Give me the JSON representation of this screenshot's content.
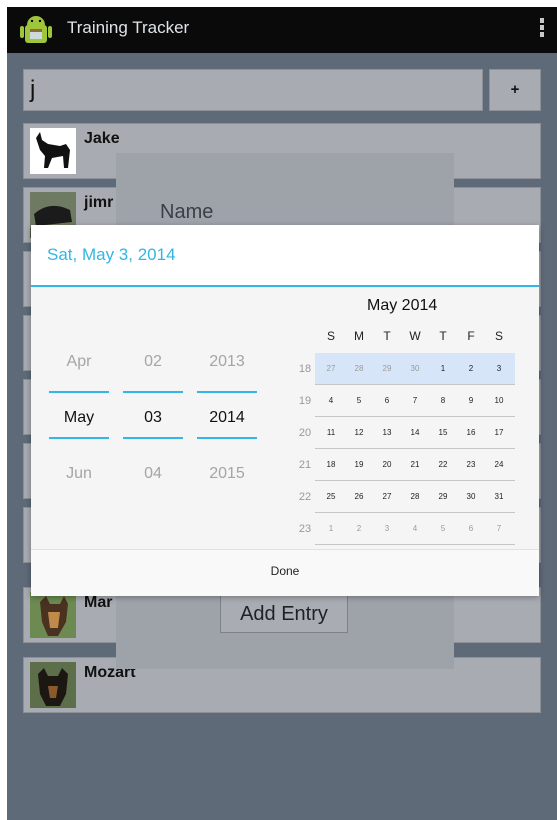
{
  "app": {
    "title": "Training Tracker"
  },
  "search": {
    "value": "j",
    "add_label": "+"
  },
  "dogs": [
    {
      "name": "Jake"
    },
    {
      "name": "jimr"
    },
    {
      "name": "Mar"
    },
    {
      "name": "Mozart"
    }
  ],
  "entry_dialog": {
    "name_label": "Name",
    "add_entry_label": "Add Entry"
  },
  "date_picker": {
    "header_date": "Sat, May 3, 2014",
    "months": {
      "prev": "Apr",
      "current": "May",
      "next": "Jun"
    },
    "days": {
      "prev": "02",
      "current": "03",
      "next": "04"
    },
    "years": {
      "prev": "2013",
      "current": "2014",
      "next": "2015"
    },
    "calendar_title": "May 2014",
    "weekdays": [
      "S",
      "M",
      "T",
      "W",
      "T",
      "F",
      "S"
    ],
    "week_numbers": [
      "18",
      "19",
      "20",
      "21",
      "22",
      "23"
    ],
    "weeks": [
      [
        "27",
        "28",
        "29",
        "30",
        "1",
        "2",
        "3"
      ],
      [
        "4",
        "5",
        "6",
        "7",
        "8",
        "9",
        "10"
      ],
      [
        "11",
        "12",
        "13",
        "14",
        "15",
        "16",
        "17"
      ],
      [
        "18",
        "19",
        "20",
        "21",
        "22",
        "23",
        "24"
      ],
      [
        "25",
        "26",
        "27",
        "28",
        "29",
        "30",
        "31"
      ],
      [
        "1",
        "2",
        "3",
        "4",
        "5",
        "6",
        "7"
      ]
    ],
    "done_label": "Done",
    "accent_color": "#33b5e5"
  }
}
